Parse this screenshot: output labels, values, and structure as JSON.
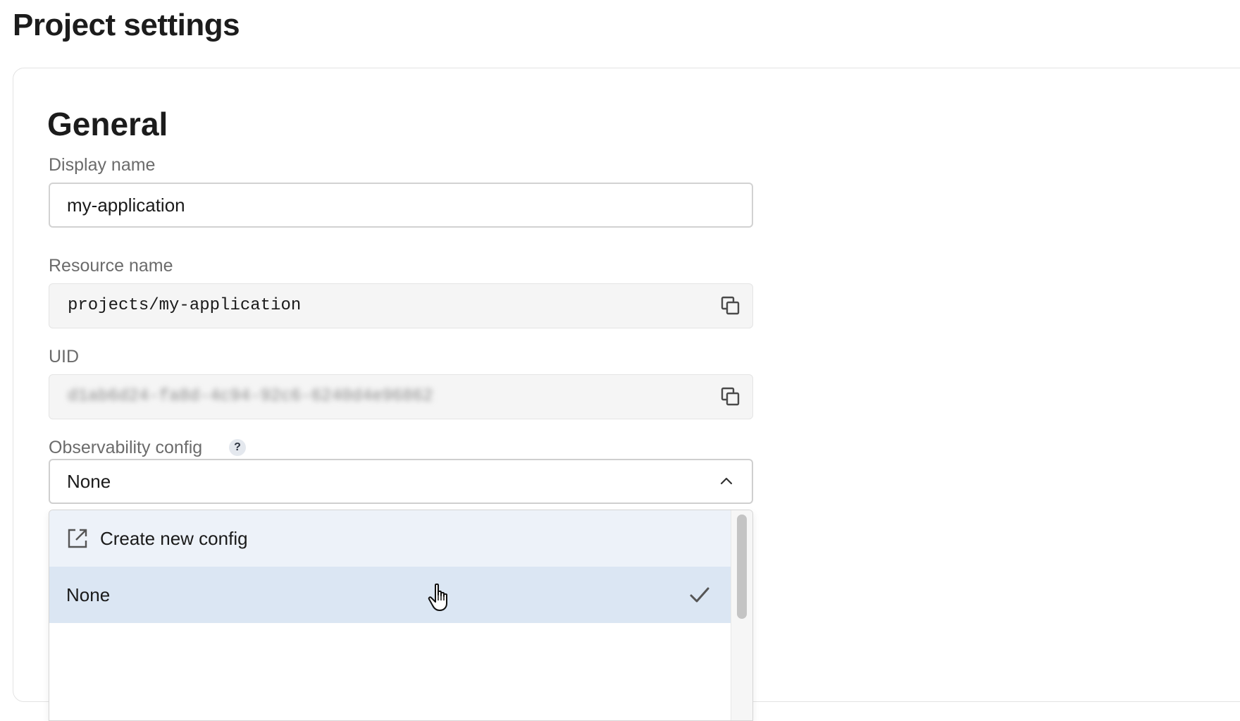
{
  "page": {
    "title": "Project settings"
  },
  "general": {
    "title": "General",
    "display_name": {
      "label": "Display name",
      "value": "my-application"
    },
    "resource_name": {
      "label": "Resource name",
      "value": "projects/my-application",
      "copy_icon": "copy-icon"
    },
    "uid": {
      "label": "UID",
      "value": "d1ab6d24-fa8d-4c94-92c6-6240d4e96862",
      "redacted": true,
      "copy_icon": "copy-icon"
    },
    "observability": {
      "label": "Observability config",
      "help_icon": "?",
      "selected": "None",
      "expanded": true,
      "options": [
        {
          "label": "Create new config",
          "icon": "external-link-icon",
          "hovered": true
        },
        {
          "label": "None",
          "selected": true,
          "icon": "check-icon"
        }
      ]
    }
  },
  "colors": {
    "option_hover_bg": "#edf2f9",
    "option_selected_bg": "#dbe6f3",
    "label_text": "#6b6b6b"
  }
}
